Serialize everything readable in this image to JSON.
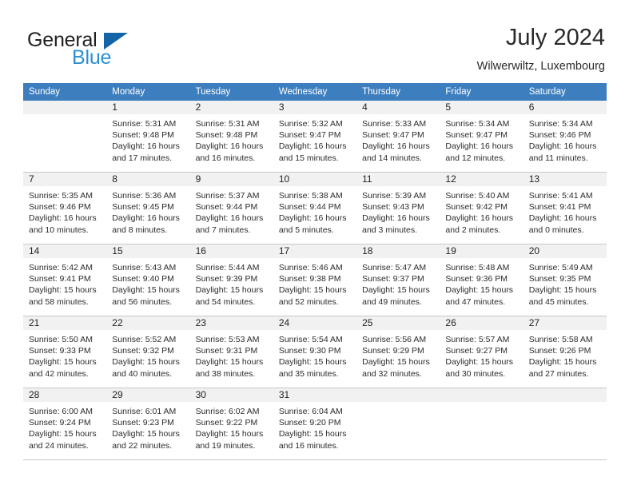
{
  "brand": {
    "name_part1": "General",
    "name_part2": "Blue",
    "accent_color": "#1464a8",
    "blue_color": "#2b8fd4"
  },
  "header": {
    "title": "July 2024",
    "subtitle": "Wilwerwiltz, Luxembourg",
    "header_bg_color": "#3d7ebf"
  },
  "weekdays": [
    "Sunday",
    "Monday",
    "Tuesday",
    "Wednesday",
    "Thursday",
    "Friday",
    "Saturday"
  ],
  "weeks": [
    [
      {
        "day": "",
        "empty": true,
        "sunrise": "",
        "sunset": "",
        "daylight1": "",
        "daylight2": ""
      },
      {
        "day": "1",
        "empty": false,
        "sunrise": "Sunrise: 5:31 AM",
        "sunset": "Sunset: 9:48 PM",
        "daylight1": "Daylight: 16 hours",
        "daylight2": "and 17 minutes."
      },
      {
        "day": "2",
        "empty": false,
        "sunrise": "Sunrise: 5:31 AM",
        "sunset": "Sunset: 9:48 PM",
        "daylight1": "Daylight: 16 hours",
        "daylight2": "and 16 minutes."
      },
      {
        "day": "3",
        "empty": false,
        "sunrise": "Sunrise: 5:32 AM",
        "sunset": "Sunset: 9:47 PM",
        "daylight1": "Daylight: 16 hours",
        "daylight2": "and 15 minutes."
      },
      {
        "day": "4",
        "empty": false,
        "sunrise": "Sunrise: 5:33 AM",
        "sunset": "Sunset: 9:47 PM",
        "daylight1": "Daylight: 16 hours",
        "daylight2": "and 14 minutes."
      },
      {
        "day": "5",
        "empty": false,
        "sunrise": "Sunrise: 5:34 AM",
        "sunset": "Sunset: 9:47 PM",
        "daylight1": "Daylight: 16 hours",
        "daylight2": "and 12 minutes."
      },
      {
        "day": "6",
        "empty": false,
        "sunrise": "Sunrise: 5:34 AM",
        "sunset": "Sunset: 9:46 PM",
        "daylight1": "Daylight: 16 hours",
        "daylight2": "and 11 minutes."
      }
    ],
    [
      {
        "day": "7",
        "empty": false,
        "sunrise": "Sunrise: 5:35 AM",
        "sunset": "Sunset: 9:46 PM",
        "daylight1": "Daylight: 16 hours",
        "daylight2": "and 10 minutes."
      },
      {
        "day": "8",
        "empty": false,
        "sunrise": "Sunrise: 5:36 AM",
        "sunset": "Sunset: 9:45 PM",
        "daylight1": "Daylight: 16 hours",
        "daylight2": "and 8 minutes."
      },
      {
        "day": "9",
        "empty": false,
        "sunrise": "Sunrise: 5:37 AM",
        "sunset": "Sunset: 9:44 PM",
        "daylight1": "Daylight: 16 hours",
        "daylight2": "and 7 minutes."
      },
      {
        "day": "10",
        "empty": false,
        "sunrise": "Sunrise: 5:38 AM",
        "sunset": "Sunset: 9:44 PM",
        "daylight1": "Daylight: 16 hours",
        "daylight2": "and 5 minutes."
      },
      {
        "day": "11",
        "empty": false,
        "sunrise": "Sunrise: 5:39 AM",
        "sunset": "Sunset: 9:43 PM",
        "daylight1": "Daylight: 16 hours",
        "daylight2": "and 3 minutes."
      },
      {
        "day": "12",
        "empty": false,
        "sunrise": "Sunrise: 5:40 AM",
        "sunset": "Sunset: 9:42 PM",
        "daylight1": "Daylight: 16 hours",
        "daylight2": "and 2 minutes."
      },
      {
        "day": "13",
        "empty": false,
        "sunrise": "Sunrise: 5:41 AM",
        "sunset": "Sunset: 9:41 PM",
        "daylight1": "Daylight: 16 hours",
        "daylight2": "and 0 minutes."
      }
    ],
    [
      {
        "day": "14",
        "empty": false,
        "sunrise": "Sunrise: 5:42 AM",
        "sunset": "Sunset: 9:41 PM",
        "daylight1": "Daylight: 15 hours",
        "daylight2": "and 58 minutes."
      },
      {
        "day": "15",
        "empty": false,
        "sunrise": "Sunrise: 5:43 AM",
        "sunset": "Sunset: 9:40 PM",
        "daylight1": "Daylight: 15 hours",
        "daylight2": "and 56 minutes."
      },
      {
        "day": "16",
        "empty": false,
        "sunrise": "Sunrise: 5:44 AM",
        "sunset": "Sunset: 9:39 PM",
        "daylight1": "Daylight: 15 hours",
        "daylight2": "and 54 minutes."
      },
      {
        "day": "17",
        "empty": false,
        "sunrise": "Sunrise: 5:46 AM",
        "sunset": "Sunset: 9:38 PM",
        "daylight1": "Daylight: 15 hours",
        "daylight2": "and 52 minutes."
      },
      {
        "day": "18",
        "empty": false,
        "sunrise": "Sunrise: 5:47 AM",
        "sunset": "Sunset: 9:37 PM",
        "daylight1": "Daylight: 15 hours",
        "daylight2": "and 49 minutes."
      },
      {
        "day": "19",
        "empty": false,
        "sunrise": "Sunrise: 5:48 AM",
        "sunset": "Sunset: 9:36 PM",
        "daylight1": "Daylight: 15 hours",
        "daylight2": "and 47 minutes."
      },
      {
        "day": "20",
        "empty": false,
        "sunrise": "Sunrise: 5:49 AM",
        "sunset": "Sunset: 9:35 PM",
        "daylight1": "Daylight: 15 hours",
        "daylight2": "and 45 minutes."
      }
    ],
    [
      {
        "day": "21",
        "empty": false,
        "sunrise": "Sunrise: 5:50 AM",
        "sunset": "Sunset: 9:33 PM",
        "daylight1": "Daylight: 15 hours",
        "daylight2": "and 42 minutes."
      },
      {
        "day": "22",
        "empty": false,
        "sunrise": "Sunrise: 5:52 AM",
        "sunset": "Sunset: 9:32 PM",
        "daylight1": "Daylight: 15 hours",
        "daylight2": "and 40 minutes."
      },
      {
        "day": "23",
        "empty": false,
        "sunrise": "Sunrise: 5:53 AM",
        "sunset": "Sunset: 9:31 PM",
        "daylight1": "Daylight: 15 hours",
        "daylight2": "and 38 minutes."
      },
      {
        "day": "24",
        "empty": false,
        "sunrise": "Sunrise: 5:54 AM",
        "sunset": "Sunset: 9:30 PM",
        "daylight1": "Daylight: 15 hours",
        "daylight2": "and 35 minutes."
      },
      {
        "day": "25",
        "empty": false,
        "sunrise": "Sunrise: 5:56 AM",
        "sunset": "Sunset: 9:29 PM",
        "daylight1": "Daylight: 15 hours",
        "daylight2": "and 32 minutes."
      },
      {
        "day": "26",
        "empty": false,
        "sunrise": "Sunrise: 5:57 AM",
        "sunset": "Sunset: 9:27 PM",
        "daylight1": "Daylight: 15 hours",
        "daylight2": "and 30 minutes."
      },
      {
        "day": "27",
        "empty": false,
        "sunrise": "Sunrise: 5:58 AM",
        "sunset": "Sunset: 9:26 PM",
        "daylight1": "Daylight: 15 hours",
        "daylight2": "and 27 minutes."
      }
    ],
    [
      {
        "day": "28",
        "empty": false,
        "sunrise": "Sunrise: 6:00 AM",
        "sunset": "Sunset: 9:24 PM",
        "daylight1": "Daylight: 15 hours",
        "daylight2": "and 24 minutes."
      },
      {
        "day": "29",
        "empty": false,
        "sunrise": "Sunrise: 6:01 AM",
        "sunset": "Sunset: 9:23 PM",
        "daylight1": "Daylight: 15 hours",
        "daylight2": "and 22 minutes."
      },
      {
        "day": "30",
        "empty": false,
        "sunrise": "Sunrise: 6:02 AM",
        "sunset": "Sunset: 9:22 PM",
        "daylight1": "Daylight: 15 hours",
        "daylight2": "and 19 minutes."
      },
      {
        "day": "31",
        "empty": false,
        "sunrise": "Sunrise: 6:04 AM",
        "sunset": "Sunset: 9:20 PM",
        "daylight1": "Daylight: 15 hours",
        "daylight2": "and 16 minutes."
      },
      {
        "day": "",
        "empty": true,
        "sunrise": "",
        "sunset": "",
        "daylight1": "",
        "daylight2": ""
      },
      {
        "day": "",
        "empty": true,
        "sunrise": "",
        "sunset": "",
        "daylight1": "",
        "daylight2": ""
      },
      {
        "day": "",
        "empty": true,
        "sunrise": "",
        "sunset": "",
        "daylight1": "",
        "daylight2": ""
      }
    ]
  ]
}
